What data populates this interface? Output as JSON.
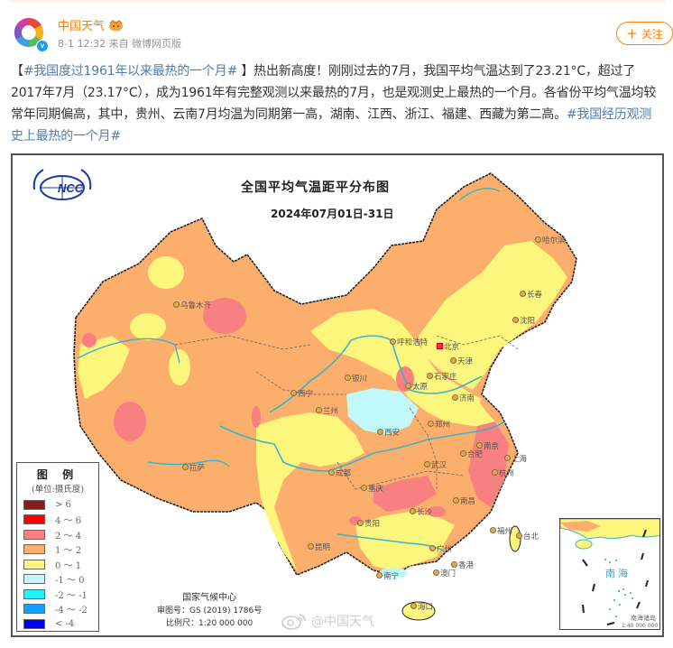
{
  "post": {
    "username": "中国天气",
    "timestamp": "8-1 12:32",
    "source": "来自 微博网页版",
    "follow_label": "关注",
    "follow_icon": "plus-icon",
    "verified_label": "v",
    "text_parts": {
      "bracket_open": "【",
      "hashtag_1": "#我国度过1961年以来最热的一个月#",
      "bracket_close": " 】",
      "body": "热出新高度！刚刚过去的7月，我国平均气温达到了23.21°C，超过了2017年7月（23.17°C），成为1961年有完整观测以来最热的7月，也是观测史上最热的一个月。各省份平均气温均较常年同期偏高，其中，贵州、云南7月均温为同期第一高，湖南、江西、浙江、福建、西藏为第二高。",
      "hashtag_2": "#我国经历观测史上最热的一个月#"
    }
  },
  "map": {
    "title": "全国平均气温距平分布图",
    "subtitle": "2024年07月01日-31日",
    "logo_text": "NCC",
    "legend": {
      "title": "图 例",
      "unit": "(单位:摄氏度)",
      "items": [
        {
          "label": "> 6",
          "color": "#8b1a1a"
        },
        {
          "label": "4 ～ 6",
          "color": "#ff0000"
        },
        {
          "label": "2 ～ 4",
          "color": "#f88080"
        },
        {
          "label": "1 ～ 2",
          "color": "#fcae6c"
        },
        {
          "label": "0 ～ 1",
          "color": "#fdf67c"
        },
        {
          "label": "-1 ～ 0",
          "color": "#c0f8fc"
        },
        {
          "label": "-2 ～ -1",
          "color": "#1cf4fc"
        },
        {
          "label": "-4 ～ -2",
          "color": "#14a0fc"
        },
        {
          "label": "< -4",
          "color": "#0000f4"
        }
      ]
    },
    "credits": {
      "org": "国家气候中心",
      "review_no": "审图号：GS (2019) 1786号",
      "scale": "比例尺：1:20 000 000"
    },
    "watermark": "@中国天气",
    "inset": {
      "sea": "南海",
      "islands": "南海诸岛",
      "scale": "1:40 000 000"
    },
    "cities": [
      {
        "name": "乌鲁木齐"
      },
      {
        "name": "哈尔滨"
      },
      {
        "name": "长春"
      },
      {
        "name": "沈阳"
      },
      {
        "name": "呼和浩特"
      },
      {
        "name": "北京",
        "capital": true
      },
      {
        "name": "天津"
      },
      {
        "name": "银川"
      },
      {
        "name": "太原"
      },
      {
        "name": "石家庄"
      },
      {
        "name": "济南"
      },
      {
        "name": "西宁"
      },
      {
        "name": "兰州"
      },
      {
        "name": "郑州"
      },
      {
        "name": "西安"
      },
      {
        "name": "拉萨"
      },
      {
        "name": "成都"
      },
      {
        "name": "重庆"
      },
      {
        "name": "武汉"
      },
      {
        "name": "合肥"
      },
      {
        "name": "南京"
      },
      {
        "name": "上海"
      },
      {
        "name": "杭州"
      },
      {
        "name": "长沙"
      },
      {
        "name": "南昌"
      },
      {
        "name": "贵阳"
      },
      {
        "name": "昆明"
      },
      {
        "name": "福州"
      },
      {
        "name": "台北"
      },
      {
        "name": "广州"
      },
      {
        "name": "南宁"
      },
      {
        "name": "澳门"
      },
      {
        "name": "香港"
      },
      {
        "name": "海口"
      }
    ]
  }
}
